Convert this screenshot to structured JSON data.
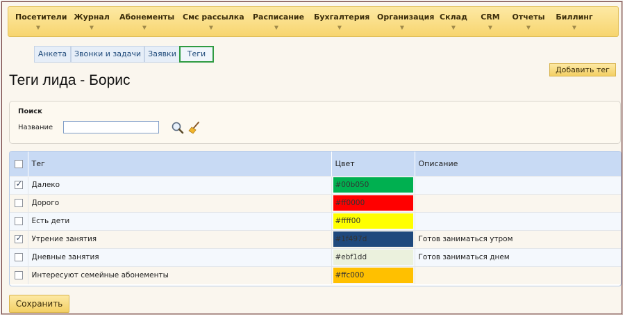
{
  "menu": [
    {
      "label": "Посетители"
    },
    {
      "label": "Журнал"
    },
    {
      "label": "Абонементы"
    },
    {
      "label": "Смс рассылка"
    },
    {
      "label": "Расписание"
    },
    {
      "label": "Бухгалтерия"
    },
    {
      "label": "Организация"
    },
    {
      "label": "Склад"
    },
    {
      "label": "CRM"
    },
    {
      "label": "Отчеты"
    },
    {
      "label": "Биллинг"
    }
  ],
  "tabs": [
    {
      "label": "Анкета"
    },
    {
      "label": "Звонки и задачи"
    },
    {
      "label": "Заявки"
    },
    {
      "label": "Теги"
    }
  ],
  "add_tag_label": "Добавить тег",
  "page_title": "Теги лида - Борис",
  "search": {
    "title": "Поиск",
    "name_label": "Название",
    "value": ""
  },
  "table": {
    "headers": {
      "tag": "Тег",
      "color": "Цвет",
      "description": "Описание"
    },
    "rows": [
      {
        "checked": true,
        "tag": "Далеко",
        "color": "#00b050",
        "description": ""
      },
      {
        "checked": false,
        "tag": "Дорого",
        "color": "#ff0000",
        "description": ""
      },
      {
        "checked": false,
        "tag": "Есть дети",
        "color": "#ffff00",
        "description": ""
      },
      {
        "checked": true,
        "tag": "Утрение занятия",
        "color": "#1f497d",
        "description": "Готов заниматься утром"
      },
      {
        "checked": false,
        "tag": "Дневные занятия",
        "color": "#ebf1dd",
        "description": "Готов заниматься днем"
      },
      {
        "checked": false,
        "tag": "Интересуют семейные абонементы",
        "color": "#ffc000",
        "description": ""
      }
    ]
  },
  "save_label": "Сохранить",
  "colors": {
    "menu_bg": "#f7d56f",
    "active_tab_border": "#2f9b42",
    "header_bg": "#c8daf4"
  },
  "icons": {
    "search": "magnifier-icon",
    "clear": "broom-icon"
  }
}
